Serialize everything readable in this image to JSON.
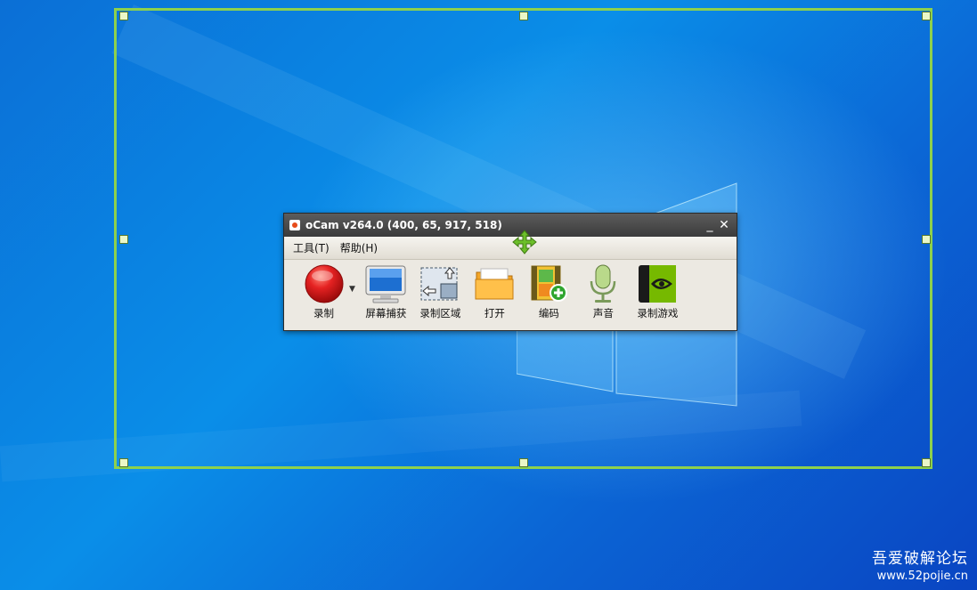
{
  "window": {
    "title": "oCam v264.0 (400, 65, 917, 518)",
    "minimize_glyph": "_",
    "close_glyph": "✕"
  },
  "menu": [
    {
      "label": "工具(T)"
    },
    {
      "label": "帮助(H)"
    }
  ],
  "toolbar": {
    "dropdown_glyph": "▼",
    "items": [
      {
        "label": "录制",
        "icon": "record-icon"
      },
      {
        "label": "屏幕捕获",
        "icon": "monitor-icon"
      },
      {
        "label": "录制区域",
        "icon": "area-icon"
      },
      {
        "label": "打开",
        "icon": "folder-icon"
      },
      {
        "label": "编码",
        "icon": "film-icon"
      },
      {
        "label": "声音",
        "icon": "microphone-icon"
      },
      {
        "label": "录制游戏",
        "icon": "game-icon"
      }
    ]
  },
  "watermark": {
    "name": "吾爱破解论坛",
    "url": "www.52pojie.cn"
  },
  "colors": {
    "capture_border": "#8dd14d",
    "record": "#e02020"
  }
}
